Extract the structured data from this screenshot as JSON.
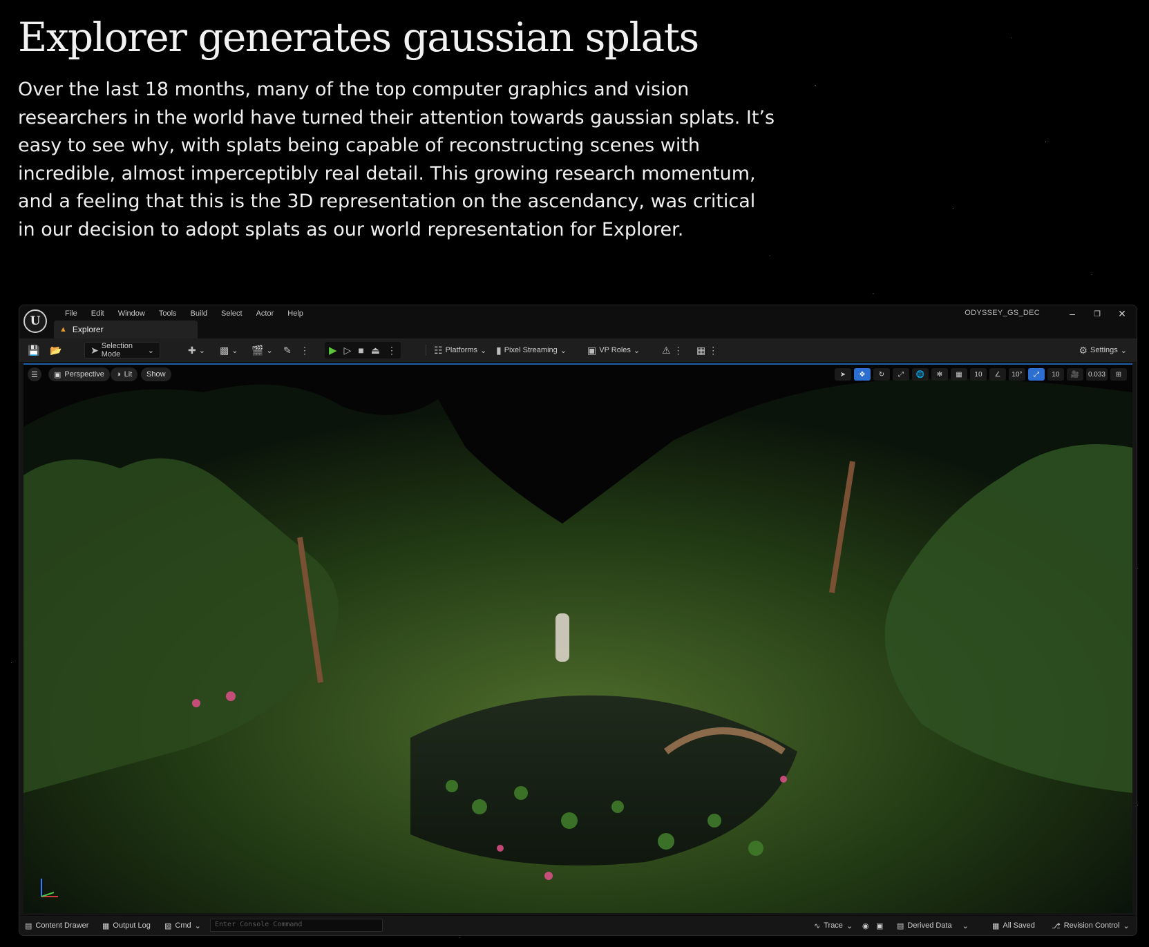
{
  "article": {
    "title": "Explorer generates gaussian splats",
    "body": "Over the last 18 months, many of the top computer graphics and vision researchers in the world have turned their attention towards gaussian splats. It’s easy to see why, with splats being capable of reconstructing scenes with incredible, almost imperceptibly real detail. This growing research momentum, and a feeling that this is the 3D representation on the ascendancy, was critical in our decision to adopt splats as our world representation for Explorer."
  },
  "editor": {
    "project_name": "ODYSSEY_GS_DEC",
    "menu": [
      "File",
      "Edit",
      "Window",
      "Tools",
      "Build",
      "Select",
      "Actor",
      "Help"
    ],
    "tab_label": "Explorer",
    "toolbar": {
      "selection_mode": "Selection Mode",
      "platforms": "Platforms",
      "pixel_streaming": "Pixel Streaming",
      "vp_roles": "VP Roles",
      "settings": "Settings"
    },
    "viewport": {
      "perspective": "Perspective",
      "lit": "Lit",
      "show": "Show",
      "grid_snap": "10",
      "rotation_snap": "10°",
      "scale_snap": "10",
      "camera_speed": "0.033"
    },
    "statusbar": {
      "content_drawer": "Content Drawer",
      "output_log": "Output Log",
      "cmd": "Cmd",
      "console_placeholder": "Enter Console Command",
      "trace": "Trace",
      "derived_data": "Derived Data",
      "all_saved": "All Saved",
      "revision_control": "Revision Control"
    }
  },
  "colors": {
    "background": "#000000",
    "accent_blue": "#2d6fd0",
    "play_green": "#5cc43b",
    "tab_icon": "#e89a2c"
  },
  "icons": [
    "unreal-logo-icon",
    "save-icon",
    "browse-icon",
    "play-icon",
    "settings-icon",
    "axis-gizmo-icon"
  ]
}
